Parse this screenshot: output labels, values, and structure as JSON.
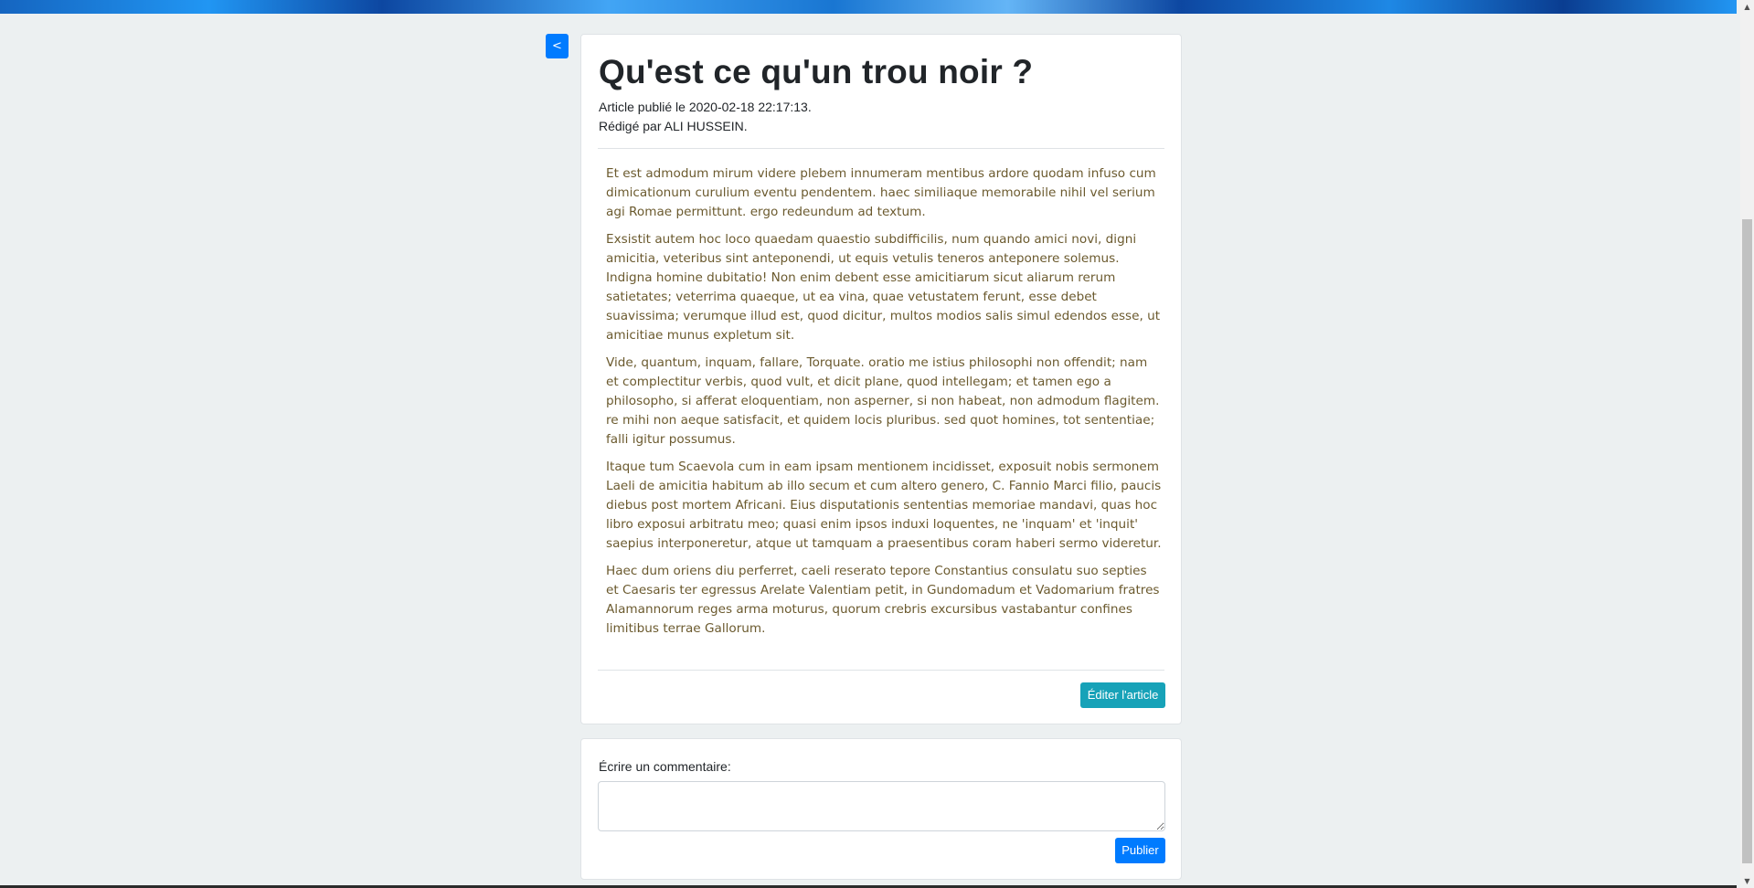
{
  "header": {
    "back_label": "<"
  },
  "article": {
    "title": "Qu'est ce qu'un trou noir ?",
    "published": "Article publié le 2020-02-18 22:17:13.",
    "author": "Rédigé par ALI HUSSEIN.",
    "paragraphs": [
      "Et est admodum mirum videre plebem innumeram mentibus ardore quodam infuso cum dimicationum curulium eventu pendentem. haec similiaque memorabile nihil vel serium agi Romae permittunt. ergo redeundum ad textum.",
      "Exsistit autem hoc loco quaedam quaestio subdifficilis, num quando amici novi, digni amicitia, veteribus sint anteponendi, ut equis vetulis teneros anteponere solemus. Indigna homine dubitatio! Non enim debent esse amicitiarum sicut aliarum rerum satietates; veterrima quaeque, ut ea vina, quae vetustatem ferunt, esse debet suavissima; verumque illud est, quod dicitur, multos modios salis simul edendos esse, ut amicitiae munus expletum sit.",
      "Vide, quantum, inquam, fallare, Torquate. oratio me istius philosophi non offendit; nam et complectitur verbis, quod vult, et dicit plane, quod intellegam; et tamen ego a philosopho, si afferat eloquentiam, non asperner, si non habeat, non admodum flagitem. re mihi non aeque satisfacit, et quidem locis pluribus. sed quot homines, tot sententiae; falli igitur possumus.",
      "Itaque tum Scaevola cum in eam ipsam mentionem incidisset, exposuit nobis sermonem Laeli de amicitia habitum ab illo secum et cum altero genero, C. Fannio Marci filio, paucis diebus post mortem Africani. Eius disputationis sententias memoriae mandavi, quas hoc libro exposui arbitratu meo; quasi enim ipsos induxi loquentes, ne 'inquam' et 'inquit' saepius interponeretur, atque ut tamquam a praesentibus coram haberi sermo videretur.",
      "Haec dum oriens diu perferret, caeli reserato tepore Constantius consulatu suo septies et Caesaris ter egressus Arelate Valentiam petit, in Gundomadum et Vadomarium fratres Alamannorum reges arma moturus, quorum crebris excursibus vastabantur confines limitibus terrae Gallorum."
    ],
    "edit_label": "Éditer l'article"
  },
  "comment": {
    "label": "Écrire un commentaire:",
    "value": "",
    "publish_label": "Publier"
  },
  "colors": {
    "primary": "#007bff",
    "info": "#17a2b8",
    "page_background": "#ecf0f1",
    "body_text": "#6b5a2e"
  }
}
